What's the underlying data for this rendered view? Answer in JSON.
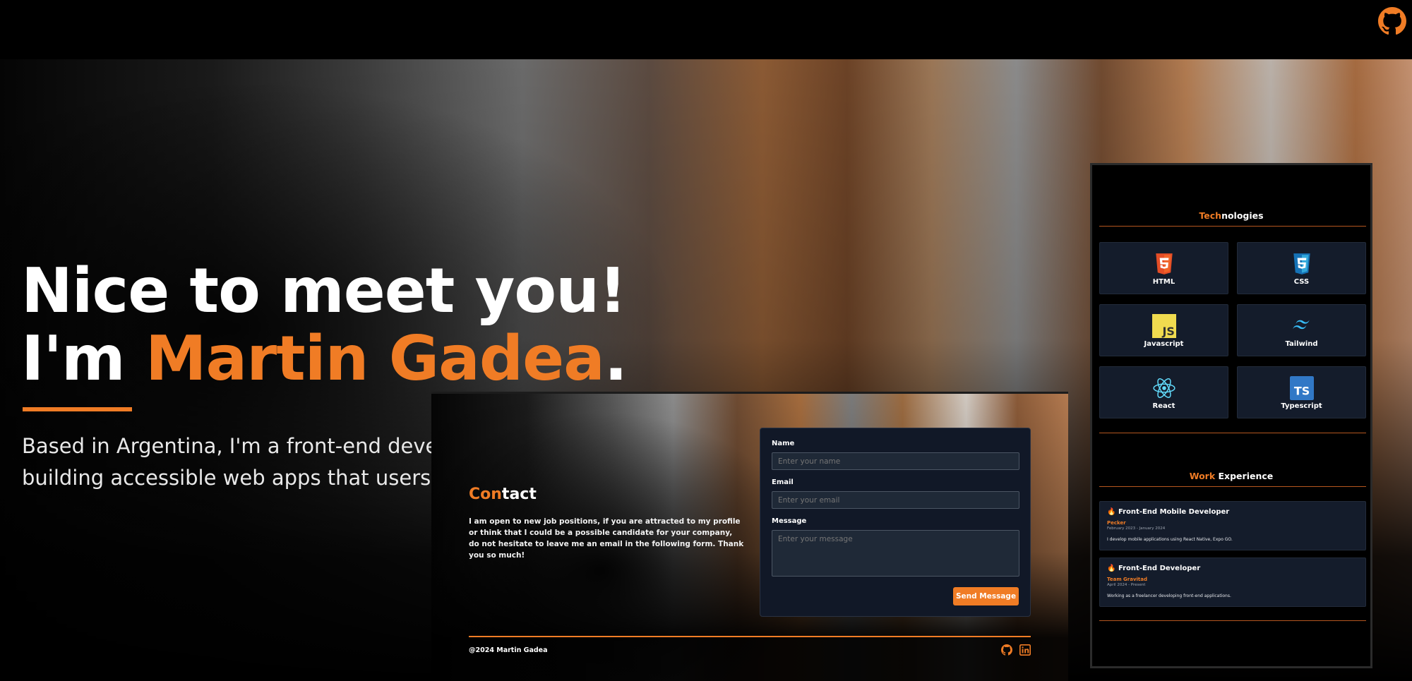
{
  "hero": {
    "title_line1": "Nice to meet you!",
    "title_line2_prefix": "I'm ",
    "title_name": "Martin Gadea",
    "title_period": ".",
    "subtitle_line1": "Based in Argentina, I'm a front-end devel",
    "subtitle_line2": "building accessible web apps that users l"
  },
  "contact": {
    "title_accent": "Con",
    "title_rest": "tact",
    "text": "I am open to new job positions, if you are attracted to my profile or think that I could be a possible candidate for your company, do not hesitate to leave me an email in the following form. Thank you so much!",
    "form": {
      "name_label": "Name",
      "name_placeholder": "Enter your name",
      "email_label": "Email",
      "email_placeholder": "Enter your email",
      "message_label": "Message",
      "message_placeholder": "Enter your message",
      "send_label": "Send Message"
    },
    "footer_copy": "@2024 Martin Gadea"
  },
  "technologies": {
    "title_accent": "Tech",
    "title_rest": "nologies",
    "items": [
      {
        "label": "HTML",
        "icon": "html5-icon"
      },
      {
        "label": "CSS",
        "icon": "css3-icon"
      },
      {
        "label": "Javascript",
        "icon": "javascript-icon"
      },
      {
        "label": "Tailwind",
        "icon": "tailwind-icon"
      },
      {
        "label": "React",
        "icon": "react-icon"
      },
      {
        "label": "Typescript",
        "icon": "typescript-icon"
      }
    ]
  },
  "experience": {
    "title_accent": "Work",
    "title_rest": " Experience",
    "jobs": [
      {
        "title": "Front-End Mobile Developer",
        "company": "Pecker",
        "dates": "February 2023 - January 2024",
        "desc": "I develop mobile applications using React Native, Expo GO."
      },
      {
        "title": "Front-End Developer",
        "company": "Team Gravitad",
        "dates": "April 2024 - Present",
        "desc": "Working as a freelancer developing front-end applications."
      }
    ]
  },
  "colors": {
    "accent": "#f07c25",
    "card": "#141c2b",
    "form_bg": "#111827"
  }
}
